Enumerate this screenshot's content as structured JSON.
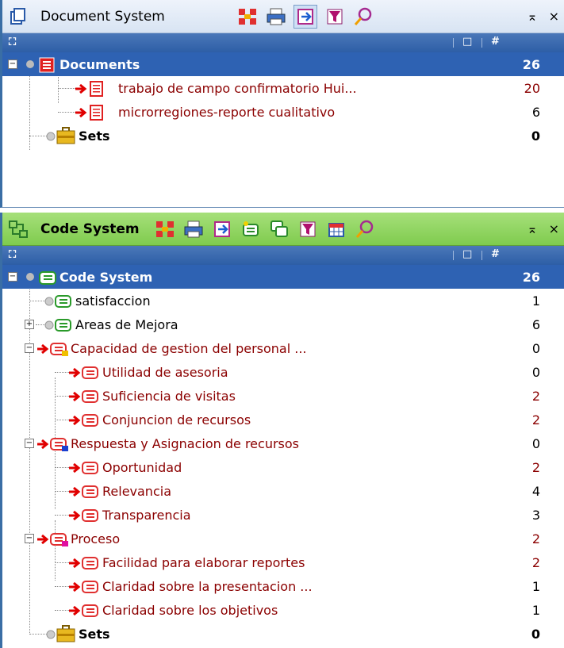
{
  "doc_panel": {
    "title": "Document System",
    "close": "×",
    "pin": "⌅",
    "columns": {
      "c1": "□",
      "c2": "#"
    },
    "rows": [
      {
        "label": "Documents",
        "count": "26"
      },
      {
        "label": "trabajo de campo confirmatorio Hui...",
        "count": "20"
      },
      {
        "label": "microrregiones-reporte cualitativo",
        "count": "6"
      },
      {
        "label": "Sets",
        "count": "0"
      }
    ]
  },
  "code_panel": {
    "title": "Code System",
    "close": "×",
    "pin": "⌅",
    "columns": {
      "c1": "□",
      "c2": "#"
    },
    "rows": [
      {
        "label": "Code System",
        "count": "26"
      },
      {
        "label": "satisfaccion",
        "count": "1"
      },
      {
        "label": "Areas de Mejora",
        "count": "6"
      },
      {
        "label": "Capacidad de gestion del personal ...",
        "count": "0"
      },
      {
        "label": "Utilidad de asesoria",
        "count": "0"
      },
      {
        "label": "Suficiencia de visitas",
        "count": "2"
      },
      {
        "label": "Conjuncion de recursos",
        "count": "2"
      },
      {
        "label": "Respuesta y Asignacion de recursos",
        "count": "0"
      },
      {
        "label": "Oportunidad",
        "count": "2"
      },
      {
        "label": "Relevancia",
        "count": "4"
      },
      {
        "label": "Transparencia",
        "count": "3"
      },
      {
        "label": "Proceso",
        "count": "2"
      },
      {
        "label": "Facilidad para elaborar reportes",
        "count": "2"
      },
      {
        "label": "Claridad sobre la presentacion ...",
        "count": "1"
      },
      {
        "label": "Claridad sobre los objetivos",
        "count": "1"
      },
      {
        "label": "Sets",
        "count": "0"
      }
    ]
  },
  "colors": {
    "selection": "#2e62b3",
    "code_title_bg": "#8fd45f",
    "doc_title_bg": "#e3ecf7",
    "red_text": "#8b0000"
  }
}
